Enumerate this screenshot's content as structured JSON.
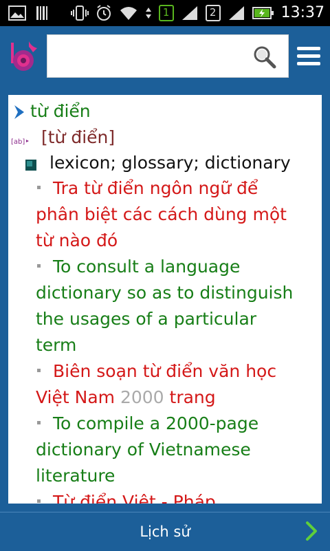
{
  "status_bar": {
    "time": "13:37",
    "sim1": "1",
    "sim2": "2"
  },
  "search": {
    "value": "",
    "placeholder": ""
  },
  "entry": {
    "headword": "từ điển",
    "part_of_speech": "[từ điển]",
    "meaning": "lexicon; glossary; dictionary",
    "ex1_vi_lines": [
      "Tra từ điển ngôn ngữ để",
      "phân biệt các cách dùng một",
      "từ nào đó"
    ],
    "ex1_en_lines": [
      "To consult a language",
      "dictionary so as to distinguish",
      "the usages of a particular",
      "term"
    ],
    "ex2_vi_line1": "Biên soạn từ điển văn học",
    "ex2_vi_line2_a": "Việt Nam ",
    "ex2_vi_line2_num": "2000",
    "ex2_vi_line2_b": " trang",
    "ex2_en_lines": [
      "To compile a 2000-page",
      "dictionary of Vietnamese",
      "literature"
    ],
    "ex3_vi_partial": "Từ điển Việt - Pháp"
  },
  "bottom": {
    "history_label": "Lịch sử"
  }
}
